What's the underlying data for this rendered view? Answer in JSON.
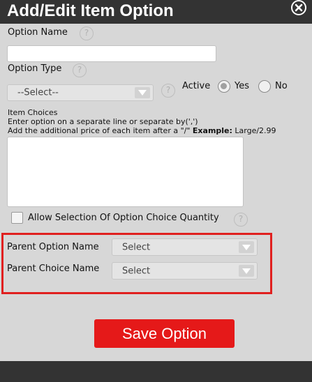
{
  "dialog": {
    "title": "Add/Edit Item Option",
    "close_icon": "close-circle-icon",
    "help_icon": "question-mark-icon"
  },
  "fields": {
    "option_name_label": "Option Name",
    "option_name_value": "",
    "option_type_label": "Option Type",
    "option_type_selected": "--Select--",
    "active_label": "Active",
    "active_yes_label": "Yes",
    "active_no_label": "No",
    "active_selected": "Yes",
    "item_choices_label": "Item Choices",
    "item_choices_hint1": "Enter option on a separate line or separate by(',')",
    "item_choices_hint2_prefix": "Add the additional price of each item after a \"/\"",
    "item_choices_example_label": "Example:",
    "item_choices_example_value": "Large/2.99",
    "item_choices_value": "",
    "allow_quantity_label": "Allow Selection Of Option Choice Quantity",
    "allow_quantity_checked": false,
    "parent_option_label": "Parent Option Name",
    "parent_option_selected": "Select",
    "parent_choice_label": "Parent Choice Name",
    "parent_choice_selected": "Select"
  },
  "actions": {
    "save_label": "Save Option"
  },
  "colors": {
    "title_bar": "#333333",
    "body": "#d7d7d7",
    "save_button": "#e51919",
    "highlight": "#e0201f"
  }
}
